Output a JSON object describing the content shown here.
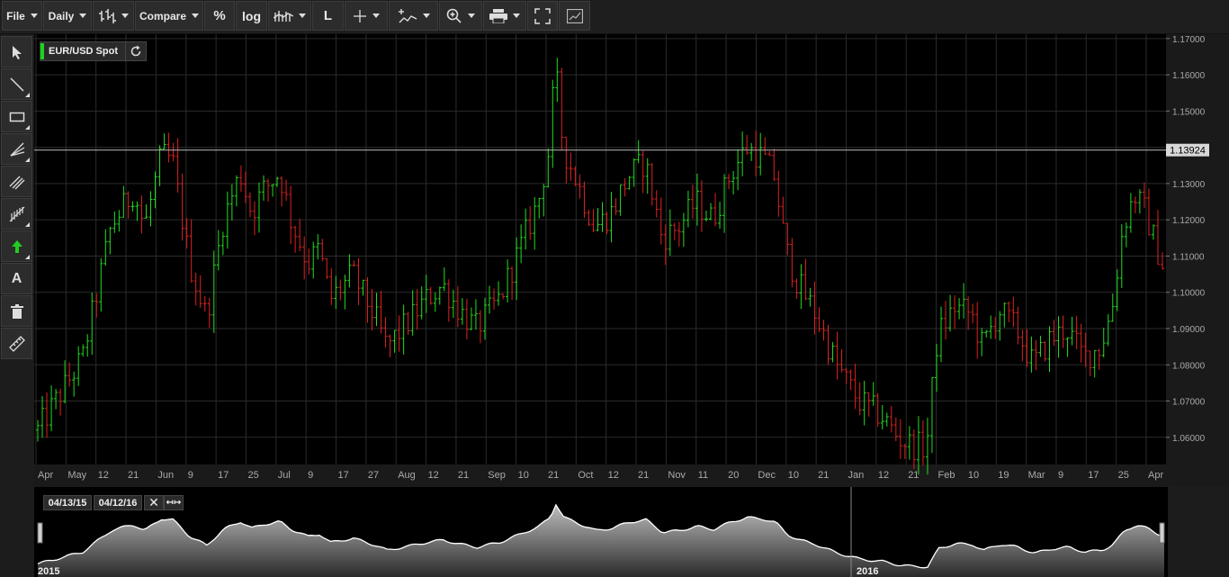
{
  "toolbar": {
    "file": "File",
    "interval": "Daily",
    "compare": "Compare",
    "percent": "%",
    "log": "log",
    "line_mode": "L"
  },
  "legend": {
    "symbol": "EUR/USD Spot"
  },
  "left_tools": [
    {
      "name": "pointer-icon"
    },
    {
      "name": "line-icon"
    },
    {
      "name": "rectangle-icon"
    },
    {
      "name": "fan-icon"
    },
    {
      "name": "channel-icon"
    },
    {
      "name": "fibonacci-icon"
    },
    {
      "name": "arrow-up-icon"
    },
    {
      "name": "text-icon"
    },
    {
      "name": "trash-icon"
    },
    {
      "name": "ruler-icon"
    }
  ],
  "navigator": {
    "start_date": "04/13/15",
    "end_date": "04/12/16",
    "year_labels": [
      "2015",
      "2016"
    ]
  },
  "colors": {
    "up": "#22dd22",
    "down": "#dd2222",
    "background": "#000000",
    "grid": "#2a2a2a"
  },
  "chart_data": {
    "type": "ohlc",
    "title": "EUR/USD Spot",
    "current_price": "1.13924",
    "y_ticks": [
      "1.17000",
      "1.16000",
      "1.15000",
      "1.14000",
      "1.13000",
      "1.12000",
      "1.11000",
      "1.10000",
      "1.09000",
      "1.08000",
      "1.07000",
      "1.06000"
    ],
    "ylim": [
      1.0525,
      1.1712
    ],
    "x_ticks": [
      "Apr",
      "May",
      "12",
      "21",
      "Jun",
      "9",
      "17",
      "25",
      "Jul",
      "9",
      "17",
      "27",
      "Aug",
      "12",
      "21",
      "Sep",
      "10",
      "21",
      "Oct",
      "12",
      "21",
      "Nov",
      "11",
      "20",
      "Dec",
      "10",
      "21",
      "Jan",
      "12",
      "21",
      "Feb",
      "10",
      "19",
      "Mar",
      "9",
      "17",
      "25",
      "Apr"
    ],
    "trend_anchors": [
      {
        "t": 0,
        "v": 1.062
      },
      {
        "t": 0.04,
        "v": 1.082
      },
      {
        "t": 0.065,
        "v": 1.118
      },
      {
        "t": 0.085,
        "v": 1.128
      },
      {
        "t": 0.095,
        "v": 1.118
      },
      {
        "t": 0.11,
        "v": 1.138
      },
      {
        "t": 0.12,
        "v": 1.136
      },
      {
        "t": 0.135,
        "v": 1.108
      },
      {
        "t": 0.15,
        "v": 1.093
      },
      {
        "t": 0.165,
        "v": 1.12
      },
      {
        "t": 0.18,
        "v": 1.133
      },
      {
        "t": 0.19,
        "v": 1.122
      },
      {
        "t": 0.2,
        "v": 1.128
      },
      {
        "t": 0.215,
        "v": 1.133
      },
      {
        "t": 0.225,
        "v": 1.12
      },
      {
        "t": 0.24,
        "v": 1.108
      },
      {
        "t": 0.25,
        "v": 1.112
      },
      {
        "t": 0.26,
        "v": 1.098
      },
      {
        "t": 0.28,
        "v": 1.105
      },
      {
        "t": 0.3,
        "v": 1.093
      },
      {
        "t": 0.31,
        "v": 1.085
      },
      {
        "t": 0.33,
        "v": 1.092
      },
      {
        "t": 0.345,
        "v": 1.098
      },
      {
        "t": 0.36,
        "v": 1.102
      },
      {
        "t": 0.375,
        "v": 1.095
      },
      {
        "t": 0.39,
        "v": 1.09
      },
      {
        "t": 0.41,
        "v": 1.098
      },
      {
        "t": 0.43,
        "v": 1.113
      },
      {
        "t": 0.445,
        "v": 1.125
      },
      {
        "t": 0.455,
        "v": 1.14
      },
      {
        "t": 0.46,
        "v": 1.163
      },
      {
        "t": 0.467,
        "v": 1.14
      },
      {
        "t": 0.48,
        "v": 1.13
      },
      {
        "t": 0.495,
        "v": 1.118
      },
      {
        "t": 0.51,
        "v": 1.122
      },
      {
        "t": 0.525,
        "v": 1.132
      },
      {
        "t": 0.54,
        "v": 1.136
      },
      {
        "t": 0.555,
        "v": 1.115
      },
      {
        "t": 0.57,
        "v": 1.118
      },
      {
        "t": 0.585,
        "v": 1.125
      },
      {
        "t": 0.6,
        "v": 1.12
      },
      {
        "t": 0.615,
        "v": 1.132
      },
      {
        "t": 0.63,
        "v": 1.14
      },
      {
        "t": 0.645,
        "v": 1.137
      },
      {
        "t": 0.655,
        "v": 1.132
      },
      {
        "t": 0.665,
        "v": 1.112
      },
      {
        "t": 0.675,
        "v": 1.103
      },
      {
        "t": 0.69,
        "v": 1.095
      },
      {
        "t": 0.71,
        "v": 1.08
      },
      {
        "t": 0.73,
        "v": 1.07
      },
      {
        "t": 0.75,
        "v": 1.066
      },
      {
        "t": 0.765,
        "v": 1.06
      },
      {
        "t": 0.775,
        "v": 1.058
      },
      {
        "t": 0.79,
        "v": 1.057
      },
      {
        "t": 0.8,
        "v": 1.088
      },
      {
        "t": 0.815,
        "v": 1.096
      },
      {
        "t": 0.83,
        "v": 1.094
      },
      {
        "t": 0.84,
        "v": 1.085
      },
      {
        "t": 0.855,
        "v": 1.095
      },
      {
        "t": 0.87,
        "v": 1.09
      },
      {
        "t": 0.885,
        "v": 1.08
      },
      {
        "t": 0.9,
        "v": 1.087
      },
      {
        "t": 0.915,
        "v": 1.09
      },
      {
        "t": 0.93,
        "v": 1.082
      },
      {
        "t": 0.945,
        "v": 1.085
      },
      {
        "t": 0.955,
        "v": 1.095
      },
      {
        "t": 0.965,
        "v": 1.118
      },
      {
        "t": 0.975,
        "v": 1.127
      },
      {
        "t": 0.985,
        "v": 1.122
      },
      {
        "t": 0.995,
        "v": 1.112
      },
      {
        "t": 1.005,
        "v": 1.104
      }
    ]
  }
}
